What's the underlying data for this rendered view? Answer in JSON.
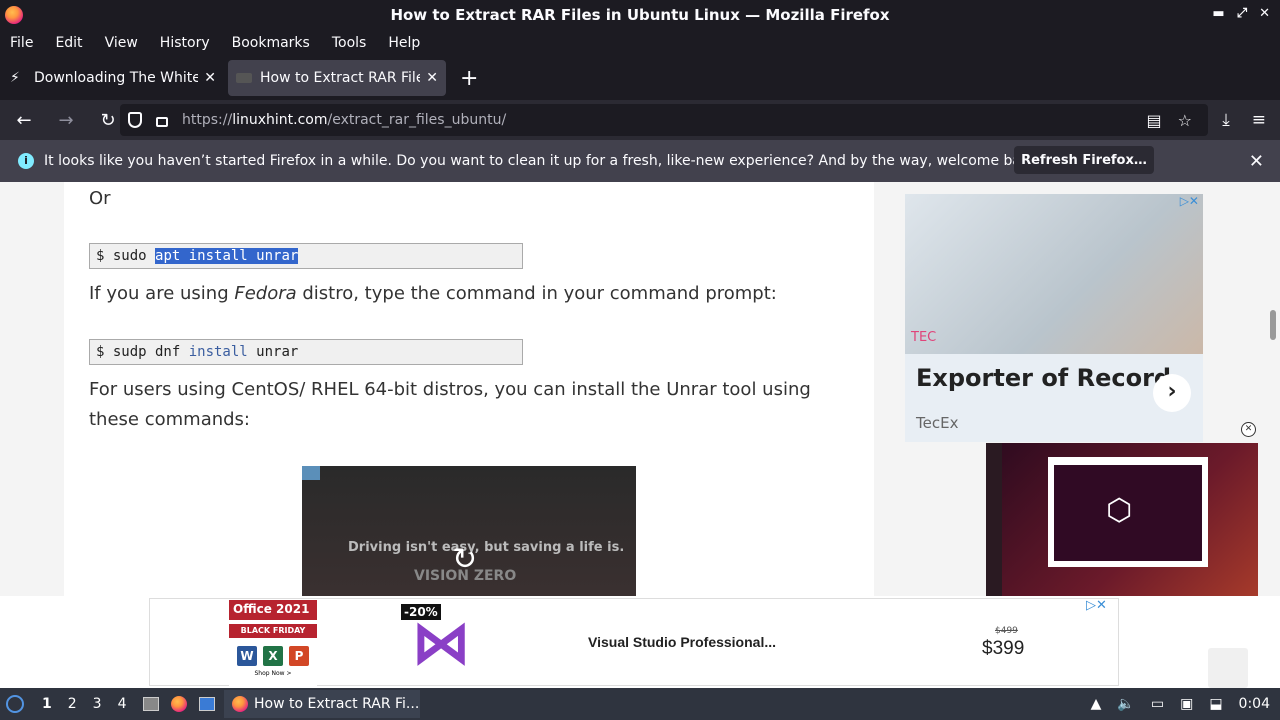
{
  "window": {
    "title": "How to Extract RAR Files in Ubuntu Linux — Mozilla Firefox"
  },
  "menu": [
    "File",
    "Edit",
    "View",
    "History",
    "Bookmarks",
    "Tools",
    "Help"
  ],
  "tabs": [
    {
      "label": "Downloading The White I"
    },
    {
      "label": "How to Extract RAR Files"
    }
  ],
  "url": {
    "protocol": "https://",
    "domain": "linuxhint.com",
    "path": "/extract_rar_files_ubuntu/"
  },
  "notification": {
    "text": "It looks like you haven’t started Firefox in a while. Do you want to clean it up for a fresh, like-new experience? And by the way, welcome back!",
    "button": "Refresh Firefox…"
  },
  "article": {
    "or": "Or",
    "code1": {
      "prompt": "$ sudo ",
      "selected": "apt install unrar"
    },
    "para1_pre": "If you are using ",
    "para1_em": "Fedora",
    "para1_post": " distro, type the command in your command prompt:",
    "code2": {
      "prompt": "$ sudp dnf ",
      "kw": "install",
      "rest": " unrar"
    },
    "para2_line1": "For users using CentOS/ RHEL 64-bit distros, you can install the Unrar tool using",
    "para2_line2": "these commands:",
    "video_caption": "Driving isn't easy, but saving a life is.",
    "video_brand": "VISION ZERO"
  },
  "side_ad": {
    "brand_mark": "TEC",
    "headline": "Exporter of Record",
    "sub": "TecEx"
  },
  "bottom_ad": {
    "office_title": "Office 2021",
    "office_sale": "BLACK FRIDAY SALE",
    "office_shop": "Shop Now >",
    "discount": "-20%",
    "product": "Visual Studio Professional...",
    "old_price": "$499",
    "price": "$399"
  },
  "taskbar": {
    "workspaces": [
      "1",
      "2",
      "3",
      "4"
    ],
    "active_app": "How to Extract RAR Fi...",
    "clock": "0:04"
  }
}
